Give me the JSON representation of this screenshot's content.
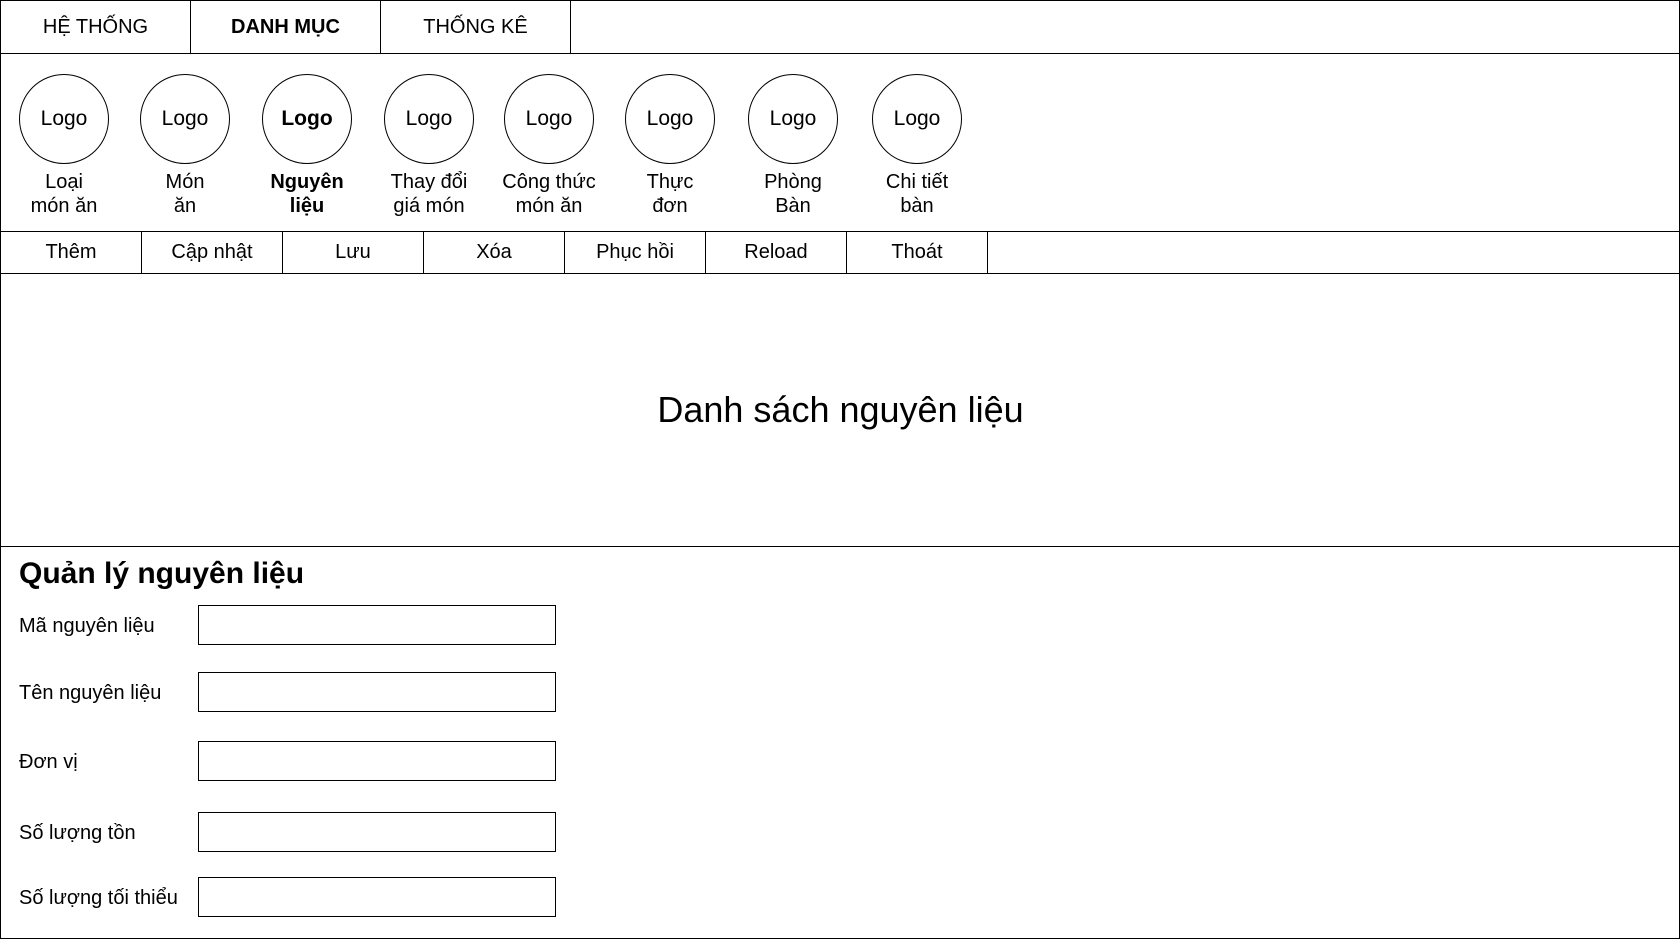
{
  "menu": {
    "tabs": [
      {
        "label": "HỆ THỐNG",
        "active": false
      },
      {
        "label": "DANH MỤC",
        "active": true
      },
      {
        "label": "THỐNG KÊ",
        "active": false
      }
    ]
  },
  "categories": [
    {
      "logo": "Logo",
      "label": "Loại\nmón ăn"
    },
    {
      "logo": "Logo",
      "label": "Món\năn"
    },
    {
      "logo": "Logo",
      "label": "Nguyên\nliệu",
      "active": true
    },
    {
      "logo": "Logo",
      "label": "Thay đổi\ngiá món"
    },
    {
      "logo": "Logo",
      "label": "Công thức\nmón ăn"
    },
    {
      "logo": "Logo",
      "label": "Thực\nđơn"
    },
    {
      "logo": "Logo",
      "label": "Phòng\nBàn"
    },
    {
      "logo": "Logo",
      "label": "Chi tiết\nbàn"
    }
  ],
  "toolbar": {
    "add": "Thêm",
    "update": "Cập nhật",
    "save": "Lưu",
    "delete": "Xóa",
    "restore": "Phục hồi",
    "reload": "Reload",
    "exit": "Thoát"
  },
  "list": {
    "title": "Danh sách nguyên liệu"
  },
  "form": {
    "title": "Quản lý nguyên liệu",
    "fields": [
      {
        "label": "Mã nguyên liệu",
        "value": ""
      },
      {
        "label": "Tên nguyên liệu",
        "value": ""
      },
      {
        "label": "Đơn vị",
        "value": ""
      },
      {
        "label": "Số lượng tồn",
        "value": ""
      },
      {
        "label": "Số lượng tối thiểu",
        "value": ""
      }
    ]
  }
}
